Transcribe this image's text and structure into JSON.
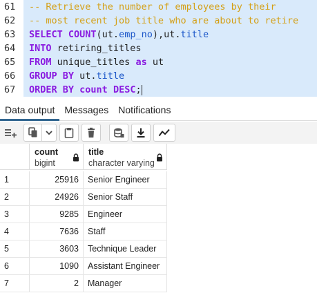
{
  "editor": {
    "lines": [
      {
        "num": "61",
        "tokens": [
          {
            "t": "-- Retrieve the number of employees by their",
            "c": "comment"
          }
        ]
      },
      {
        "num": "62",
        "tokens": [
          {
            "t": "-- most recent job title who are about to retire",
            "c": "comment"
          }
        ]
      },
      {
        "num": "63",
        "tokens": [
          {
            "t": "SELECT COUNT",
            "c": "kw"
          },
          {
            "t": "(ut.",
            "c": "ident"
          },
          {
            "t": "emp_no",
            "c": "col"
          },
          {
            "t": "),ut.",
            "c": "ident"
          },
          {
            "t": "title",
            "c": "col"
          }
        ]
      },
      {
        "num": "64",
        "tokens": [
          {
            "t": "INTO",
            "c": "kw"
          },
          {
            "t": " retiring_titles",
            "c": "ident"
          }
        ]
      },
      {
        "num": "65",
        "tokens": [
          {
            "t": "FROM",
            "c": "kw"
          },
          {
            "t": " unique_titles ",
            "c": "ident"
          },
          {
            "t": "as",
            "c": "kw"
          },
          {
            "t": " ut",
            "c": "ident"
          }
        ]
      },
      {
        "num": "66",
        "tokens": [
          {
            "t": "GROUP BY",
            "c": "kw"
          },
          {
            "t": " ut.",
            "c": "ident"
          },
          {
            "t": "title",
            "c": "col"
          }
        ]
      },
      {
        "num": "67",
        "tokens": [
          {
            "t": "ORDER BY",
            "c": "kw"
          },
          {
            "t": " ",
            "c": "ident"
          },
          {
            "t": "count",
            "c": "kw"
          },
          {
            "t": " ",
            "c": "ident"
          },
          {
            "t": "DESC",
            "c": "kw"
          },
          {
            "t": ";",
            "c": "ident"
          }
        ]
      }
    ]
  },
  "tabs": [
    {
      "label": "Data output",
      "active": true
    },
    {
      "label": "Messages",
      "active": false
    },
    {
      "label": "Notifications",
      "active": false
    }
  ],
  "toolbar": {
    "icons": [
      "add-row-icon",
      "copy-icon",
      "chevron-down-icon",
      "paste-icon",
      "delete-icon",
      "save-data-icon",
      "download-icon",
      "graph-icon"
    ]
  },
  "grid": {
    "columns": [
      {
        "name": "count",
        "type": "bigint"
      },
      {
        "name": "title",
        "type": "character varying"
      }
    ],
    "rows": [
      {
        "num": "1",
        "count": "25916",
        "title": "Senior Engineer"
      },
      {
        "num": "2",
        "count": "24926",
        "title": "Senior Staff"
      },
      {
        "num": "3",
        "count": "9285",
        "title": "Engineer"
      },
      {
        "num": "4",
        "count": "7636",
        "title": "Staff"
      },
      {
        "num": "5",
        "count": "3603",
        "title": "Technique Leader"
      },
      {
        "num": "6",
        "count": "1090",
        "title": "Assistant Engineer"
      },
      {
        "num": "7",
        "count": "2",
        "title": "Manager"
      }
    ]
  },
  "colors": {
    "comment": "#d4a017",
    "keyword": "#8a1be0",
    "column": "#1a55c8",
    "selection": "#d9eafb",
    "active_tab": "#326690"
  }
}
